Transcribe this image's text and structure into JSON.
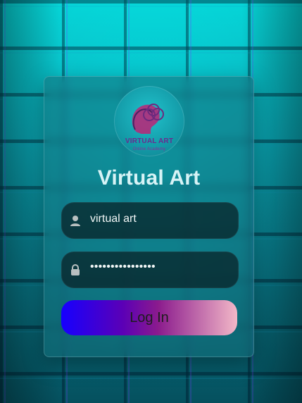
{
  "logo": {
    "name": "VIRTUAL ART",
    "tagline": "Online Academy"
  },
  "login": {
    "title": "Virtual Art",
    "username_value": "virtual art",
    "password_value": "••••••••••••••••",
    "button_label": "Log In"
  },
  "icons": {
    "user_icon": "user-icon",
    "lock_icon": "lock-icon"
  }
}
